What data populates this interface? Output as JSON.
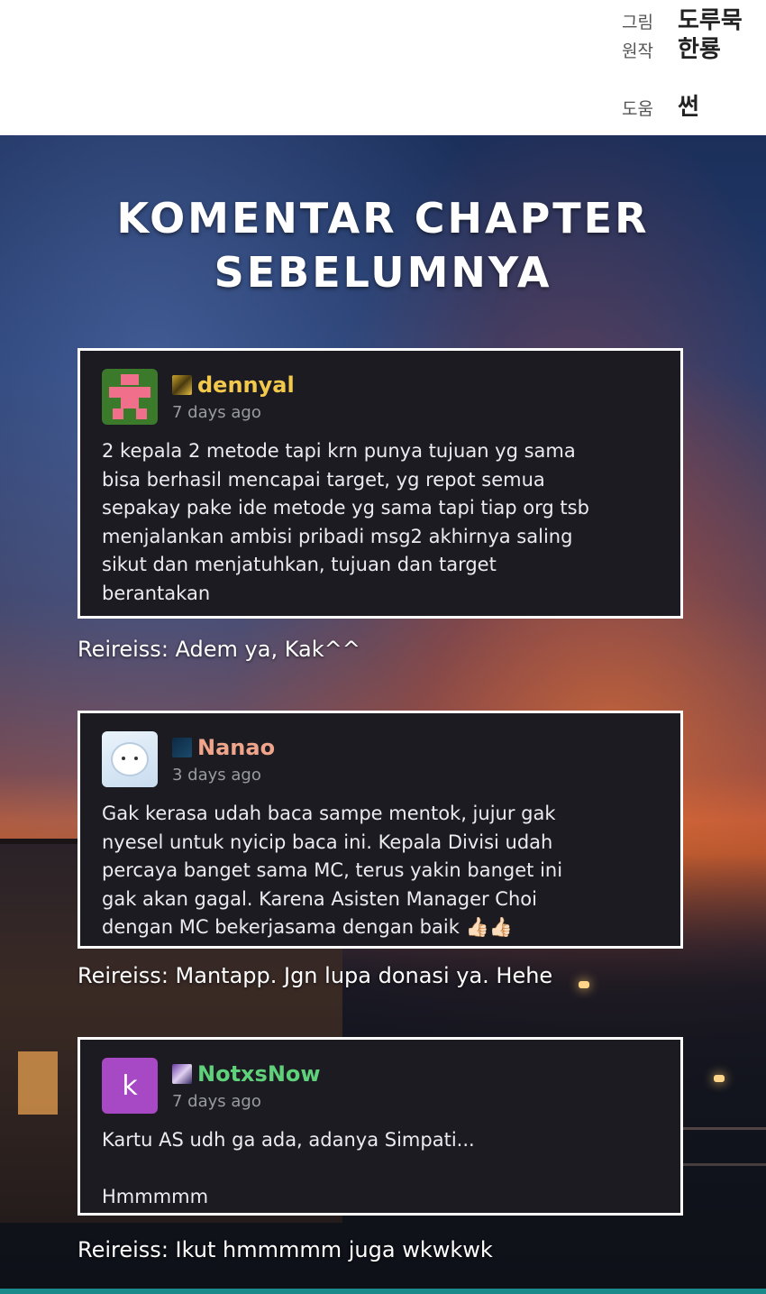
{
  "credits": [
    {
      "role": "그림",
      "name": "도루묵"
    },
    {
      "role": "원작",
      "name": "한룡"
    },
    {
      "role": "도움",
      "name": "썬"
    }
  ],
  "title": {
    "line1": "KOMENTAR CHAPTER",
    "line2": "SEBELUMNYA"
  },
  "comments": [
    {
      "username": "dennyal",
      "username_color": "#f2c94c",
      "time": "7 days ago",
      "avatar_icon": "pixel-character-icon",
      "body": "2 kepala 2 metode tapi krn punya tujuan yg sama\nbisa berhasil mencapai target, yg repot semua\nsepakay pake ide metode yg sama tapi tiap org tsb\nmenjalankan ambisi pribadi msg2 akhirnya saling\nsikut dan menjatuhkan, tujuan dan target\nberantakan",
      "reply": "Reireiss: Adem ya, Kak^^"
    },
    {
      "username": "Nanao",
      "username_color": "#f0a58a",
      "time": "3 days ago",
      "avatar_icon": "white-bear-icon",
      "body": "Gak kerasa udah baca sampe mentok, jujur gak\nnyesel untuk nyicip baca ini. Kepala Divisi udah\npercaya banget sama MC, terus yakin banget ini\ngak akan gagal. Karena Asisten Manager Choi\ndengan MC bekerjasama dengan baik 👍🏻👍🏻",
      "reply": "Reireiss: Mantapp. Jgn lupa donasi ya. Hehe"
    },
    {
      "username": "NotxsNow",
      "username_color": "#5fd17a",
      "time": "7 days ago",
      "avatar_letter": "k",
      "body": "Kartu AS udh ga ada, adanya Simpati...\n\nHmmmmm",
      "reply": "Reireiss: Ikut hmmmmm juga wkwkwk"
    }
  ]
}
